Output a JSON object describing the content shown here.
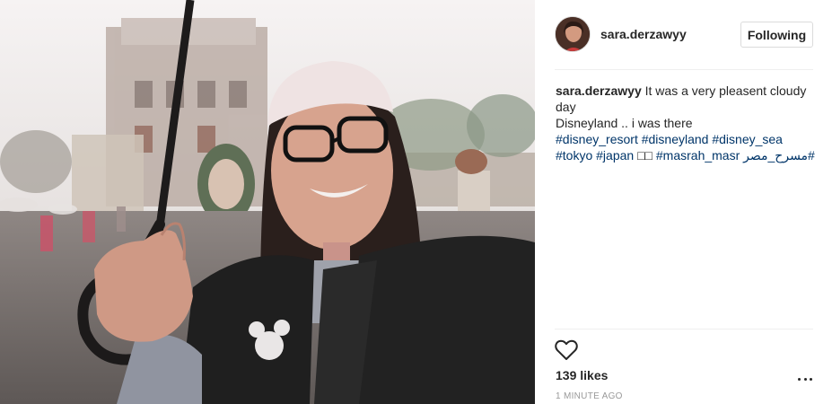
{
  "post": {
    "photo": {
      "icon": "photo-image",
      "subject": "woman with umbrella in rain"
    },
    "author": {
      "username": "sara.derzawyy",
      "avatar_icon": "avatar-image"
    },
    "follow_button": {
      "label": "Following"
    },
    "caption": {
      "author": "sara.derzawyy",
      "text_line1": "It was a very pleasent cloudy",
      "text_line2": "day",
      "text_line3": "Disneyland .. i was there",
      "hashtags_line1": [
        "#disney_resort",
        "#disneyland",
        "#disney_sea"
      ],
      "hashtags_line2": [
        "#tokyo",
        "#japan",
        "□□",
        "#masrah_masr",
        "#مسرح_مصر"
      ]
    },
    "likes": "139 likes",
    "timestamp": "1 MINUTE AGO",
    "icons": {
      "like": "heart-icon",
      "more": "more-options-icon"
    },
    "colors": {
      "hashtag": "#003569",
      "text": "#262626",
      "muted": "#999999",
      "border": "#dbdbdb"
    }
  }
}
